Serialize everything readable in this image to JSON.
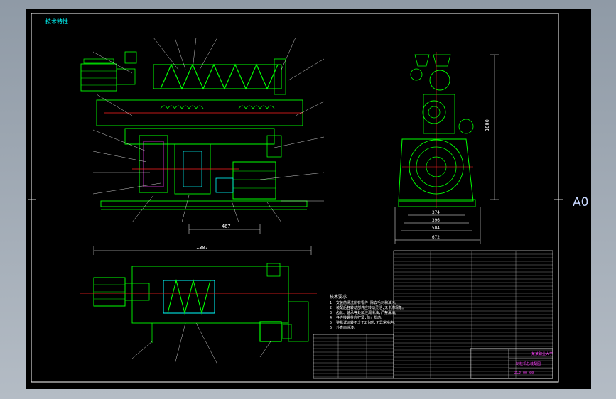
{
  "sheet": {
    "size_label": "A0",
    "frame_title": "技术特性"
  },
  "colors": {
    "background": "#000000",
    "outer_frame": "#ffffff",
    "geometry": "#00ff00",
    "centerline": "#ff2020",
    "dimension": "#ffffff",
    "leader_label": "#ff40ff",
    "accent": "#00ffff"
  },
  "dimensions": {
    "front_width": "467",
    "top_length": "1307",
    "side_height": "1800",
    "side_base_1": "374",
    "side_base_2": "396",
    "side_base_3": "504",
    "side_base_4": "672"
  },
  "technical_notes": {
    "title": "技术要求",
    "lines": [
      "1. 安装前清洗所有零件,除去毛刺和油污。",
      "2. 装配后各转动部件应转动灵活,无卡滞现象。",
      "3. 齿轮、轴承等处加注润滑油,严禁漏油。",
      "4. 各连接螺栓应拧紧,防止松动。",
      "5. 整机试运转不少于2小时,无异常噪声。",
      "6. 外表面涂漆。"
    ]
  },
  "title_block": {
    "school": "某某职业大学",
    "drawing_name": "制粒机总装配图",
    "drawing_no": "ZLJ-00-00"
  }
}
